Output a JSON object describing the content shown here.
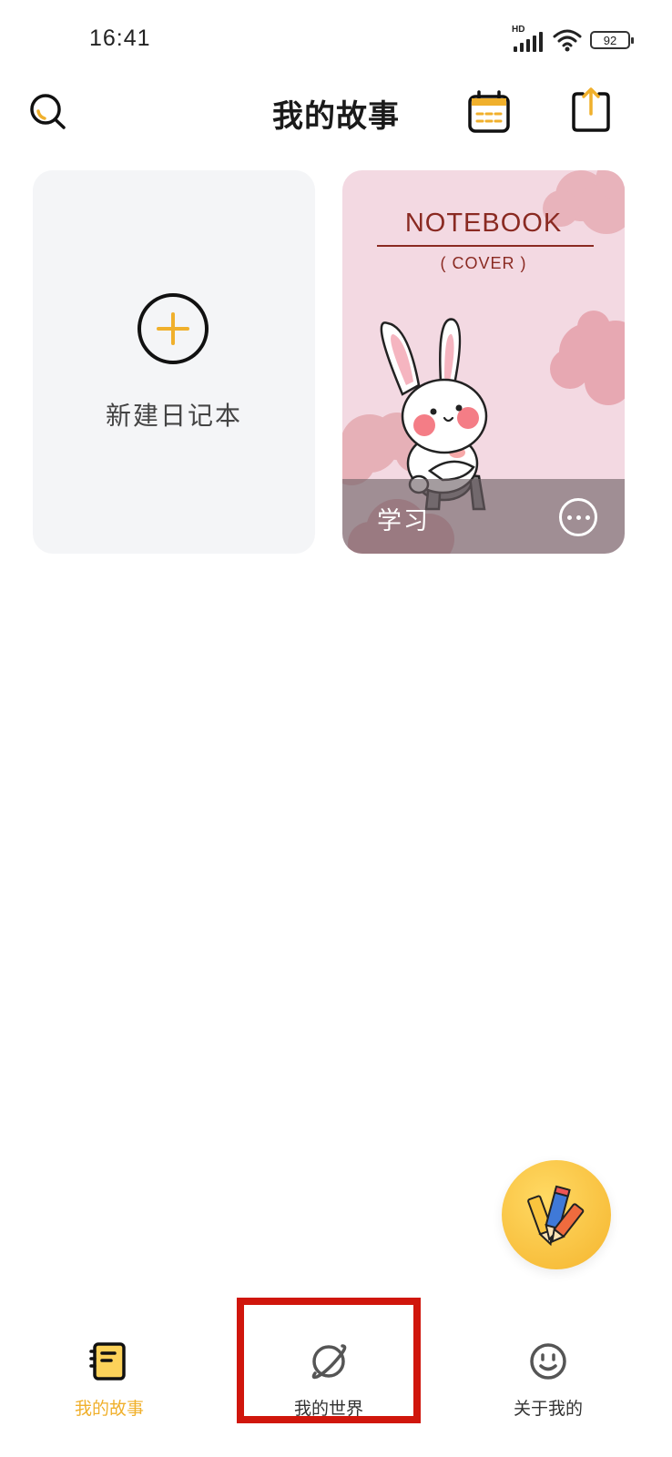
{
  "status_bar": {
    "time": "16:41",
    "network_label": "HD",
    "battery_level": "92"
  },
  "header": {
    "title": "我的故事",
    "icons": [
      "search-icon",
      "calendar-icon",
      "share-upload-icon"
    ]
  },
  "notebooks": {
    "new_card_label": "新建日记本",
    "items": [
      {
        "cover_title": "NOTEBOOK",
        "cover_subtitle": "( COVER )",
        "name": "学习"
      }
    ]
  },
  "fab": {
    "icon": "pencils-icon"
  },
  "bottom_nav": {
    "items": [
      {
        "label": "我的故事",
        "icon": "notebook-icon",
        "active": true
      },
      {
        "label": "我的世界",
        "icon": "planet-icon",
        "active": false
      },
      {
        "label": "关于我的",
        "icon": "smiley-icon",
        "active": false
      }
    ]
  },
  "colors": {
    "accent": "#f0b02c",
    "highlight_box": "#d0160c",
    "cover_background": "#f3d9e2",
    "cover_text": "#8a2a22"
  }
}
